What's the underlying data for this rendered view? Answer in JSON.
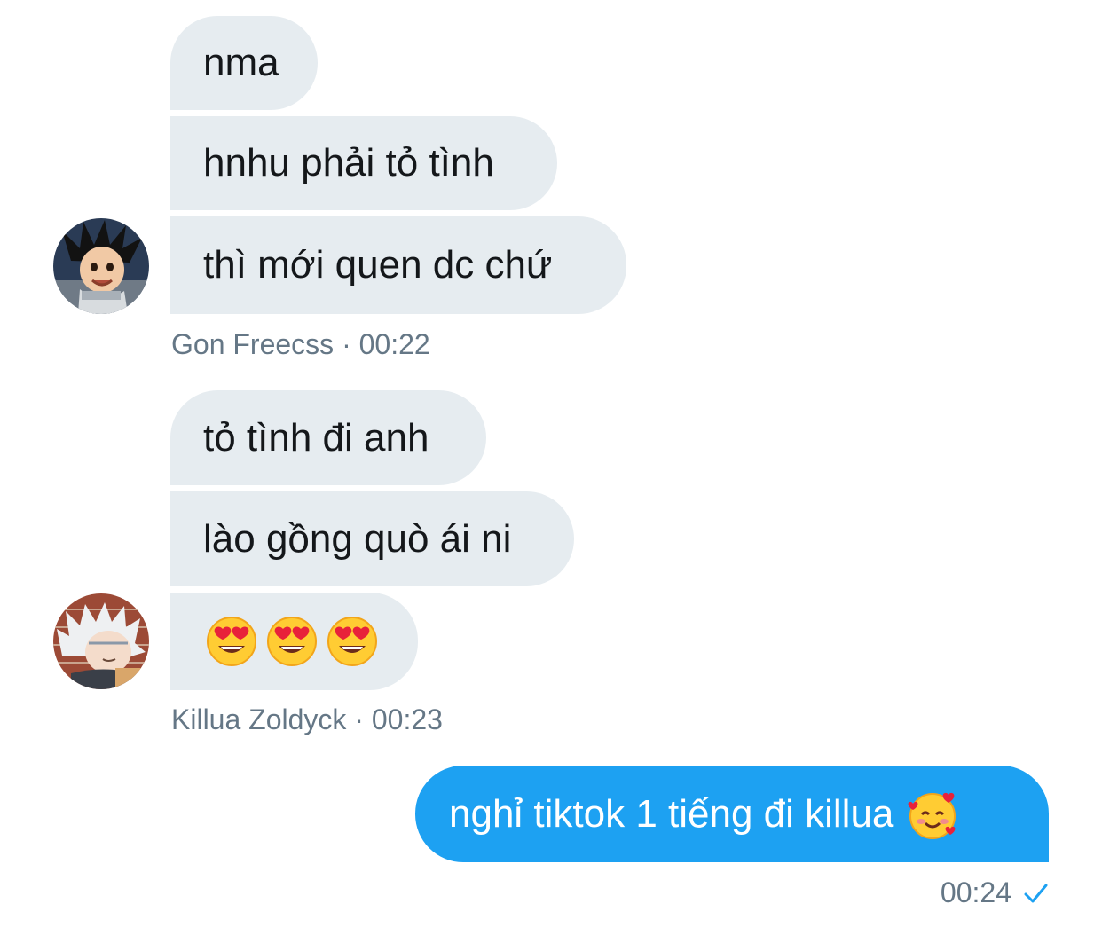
{
  "thread": {
    "group1": {
      "messages": [
        "nma",
        "hnhu phải tỏ tình",
        "thì mới quen dc chứ"
      ],
      "sender": "Gon Freecss",
      "time": "00:22",
      "avatar_icon": "gon-avatar-icon"
    },
    "group2": {
      "messages": [
        "tỏ tình đi anh",
        "lào gồng quò ái ni"
      ],
      "emoji_message": [
        "heart-eyes-emoji",
        "heart-eyes-emoji",
        "heart-eyes-emoji"
      ],
      "sender": "Killua Zoldyck",
      "time": "00:23",
      "avatar_icon": "killua-avatar-icon"
    },
    "outgoing": {
      "message": "nghỉ tiktok 1 tiếng đi killua",
      "emoji": "smiling-face-with-hearts-emoji",
      "time": "00:24",
      "status_icon": "checkmark-icon"
    }
  },
  "colors": {
    "incoming_bubble": "#e6ecf0",
    "outgoing_bubble": "#1da1f2",
    "meta_text": "#657786",
    "check": "#1da1f2"
  }
}
